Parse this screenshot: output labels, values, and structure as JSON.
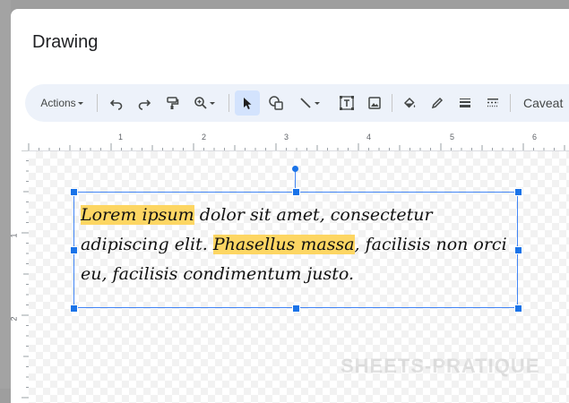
{
  "dialog": {
    "title": "Drawing"
  },
  "toolbar": {
    "actions_label": "Actions",
    "font_label": "Caveat",
    "icons": [
      "undo-icon",
      "redo-icon",
      "paint-format-icon",
      "zoom-icon",
      "select-icon",
      "shape-icon",
      "line-icon",
      "text-box-icon",
      "image-icon",
      "fill-color-icon",
      "border-color-icon",
      "border-weight-icon",
      "border-dash-icon"
    ]
  },
  "ruler": {
    "horizontal": [
      "1",
      "2",
      "3",
      "4",
      "5",
      "6"
    ],
    "vertical": [
      "1",
      "2"
    ]
  },
  "textbox": {
    "segments": [
      {
        "text": "Lorem ipsum",
        "highlight": true
      },
      {
        "text": " dolor sit amet, consectetur adipiscing elit. ",
        "highlight": false
      },
      {
        "text": "Phasellus massa",
        "highlight": true
      },
      {
        "text": ", facilisis non orci eu, facilisis condimentum justo.",
        "highlight": false
      }
    ],
    "highlight_color": "#fdd663",
    "border_color": "#4285f4"
  },
  "watermark": "SHEETS-PRATIQUE"
}
